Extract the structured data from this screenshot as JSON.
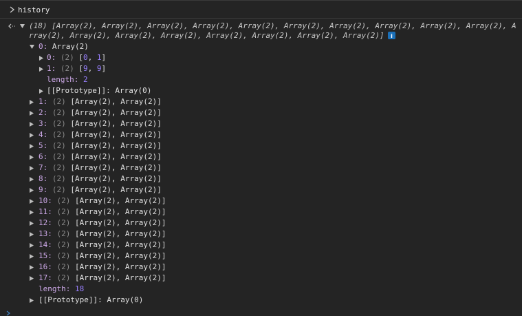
{
  "console": {
    "input": "history",
    "summary_line1": "(18) [Array(2), Array(2), Array(2), Array(2), Array(2), Array(2), Array(2), Array(2), Array(2), Array(2), A",
    "summary_line2": "rray(2), Array(2), Array(2), Array(2), Array(2), Array(2), Array(2), Array(2)]",
    "badge": "i",
    "expanded_item": {
      "key": "0",
      "label": "Array(2)",
      "children": [
        {
          "key": "0",
          "count": "(2)",
          "open": "[",
          "a": "0",
          "sep": ", ",
          "b": "1",
          "close": "]"
        },
        {
          "key": "1",
          "count": "(2)",
          "open": "[",
          "a": "9",
          "sep": ", ",
          "b": "9",
          "close": "]"
        }
      ],
      "length_key": "length",
      "length_value": "2",
      "prototype_key": "[[Prototype]]",
      "prototype_value": "Array(0)"
    },
    "items": [
      {
        "key": "1",
        "count": "(2)",
        "value": "[Array(2), Array(2)]"
      },
      {
        "key": "2",
        "count": "(2)",
        "value": "[Array(2), Array(2)]"
      },
      {
        "key": "3",
        "count": "(2)",
        "value": "[Array(2), Array(2)]"
      },
      {
        "key": "4",
        "count": "(2)",
        "value": "[Array(2), Array(2)]"
      },
      {
        "key": "5",
        "count": "(2)",
        "value": "[Array(2), Array(2)]"
      },
      {
        "key": "6",
        "count": "(2)",
        "value": "[Array(2), Array(2)]"
      },
      {
        "key": "7",
        "count": "(2)",
        "value": "[Array(2), Array(2)]"
      },
      {
        "key": "8",
        "count": "(2)",
        "value": "[Array(2), Array(2)]"
      },
      {
        "key": "9",
        "count": "(2)",
        "value": "[Array(2), Array(2)]"
      },
      {
        "key": "10",
        "count": "(2)",
        "value": "[Array(2), Array(2)]"
      },
      {
        "key": "11",
        "count": "(2)",
        "value": "[Array(2), Array(2)]"
      },
      {
        "key": "12",
        "count": "(2)",
        "value": "[Array(2), Array(2)]"
      },
      {
        "key": "13",
        "count": "(2)",
        "value": "[Array(2), Array(2)]"
      },
      {
        "key": "14",
        "count": "(2)",
        "value": "[Array(2), Array(2)]"
      },
      {
        "key": "15",
        "count": "(2)",
        "value": "[Array(2), Array(2)]"
      },
      {
        "key": "16",
        "count": "(2)",
        "value": "[Array(2), Array(2)]"
      },
      {
        "key": "17",
        "count": "(2)",
        "value": "[Array(2), Array(2)]"
      }
    ],
    "length_key": "length",
    "length_value": "18",
    "prototype_key": "[[Prototype]]",
    "prototype_value": "Array(0)"
  }
}
